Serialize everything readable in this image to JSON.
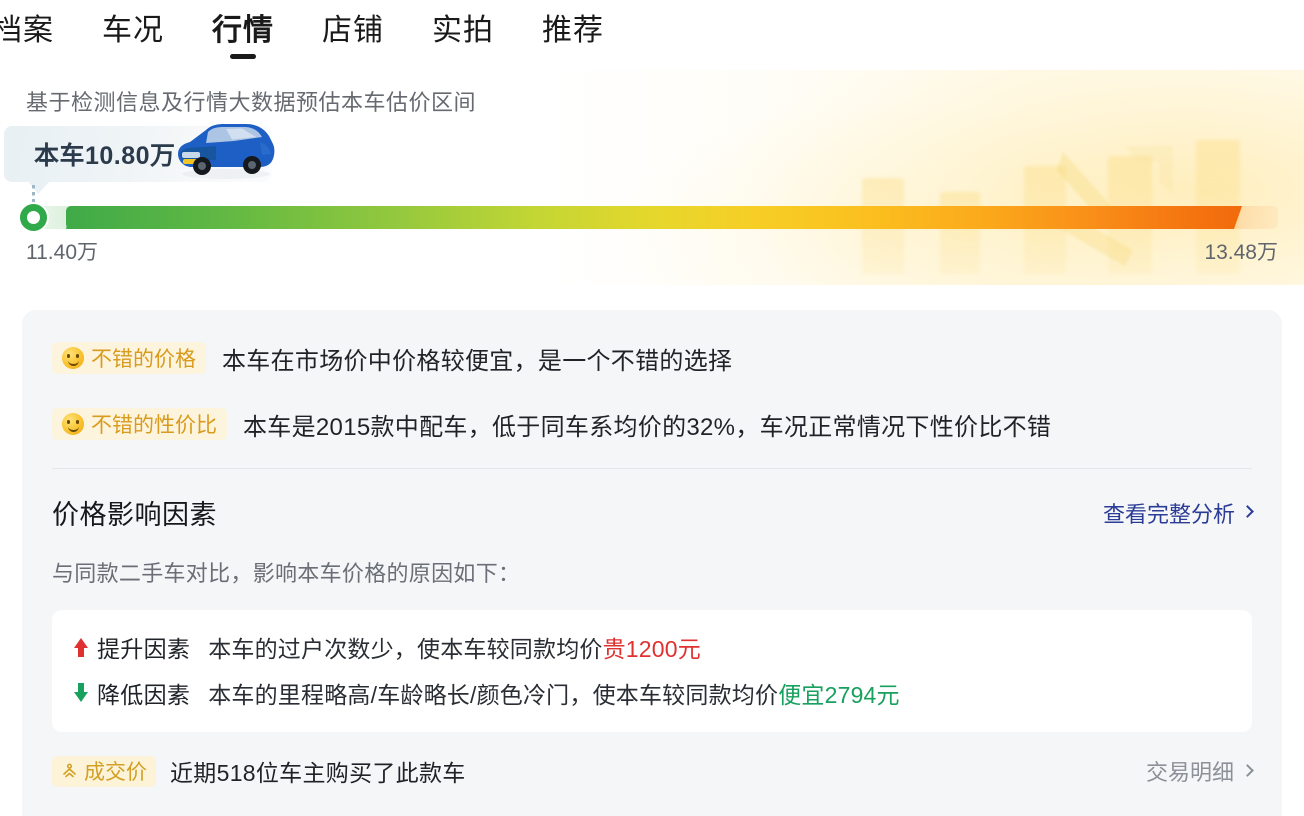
{
  "nav": {
    "items": [
      {
        "label": "档案",
        "active": false
      },
      {
        "label": "车况",
        "active": false
      },
      {
        "label": "行情",
        "active": true
      },
      {
        "label": "店铺",
        "active": false
      },
      {
        "label": "实拍",
        "active": false
      },
      {
        "label": "推荐",
        "active": false
      }
    ]
  },
  "hero": {
    "caption": "基于检测信息及行情大数据预估本车估价区间",
    "bubble_price": "本车10.80万",
    "range_min_label": "11.40万",
    "range_max_label": "13.48万",
    "car_body_color": "#1d5fc4",
    "marker_color": "#2fa94a",
    "gradient_start": "#3faa48",
    "gradient_mid": "#e6d72c",
    "gradient_end": "#f26a0c"
  },
  "assessments": [
    {
      "badge": "不错的价格",
      "icon": "smiley-face-icon",
      "text": "本车在市场价中价格较便宜，是一个不错的选择"
    },
    {
      "badge": "不错的性价比",
      "icon": "smiley-face-icon",
      "text": "本车是2015款中配车，低于同车系均价的32%，车况正常情况下性价比不错"
    }
  ],
  "factors_section": {
    "title": "价格影响因素",
    "link": "查看完整分析",
    "subtitle": "与同款二手车对比，影响本车价格的原因如下：",
    "rows": [
      {
        "direction": "up",
        "label": "提升因素",
        "desc": "本车的过户次数少，使本车较同款均价",
        "highlight": "贵1200元",
        "highlight_color": "#e03131"
      },
      {
        "direction": "down",
        "label": "降低因素",
        "desc": "本车的里程略高/车龄略长/颜色冷门，使本车较同款均价",
        "highlight": "便宜2794元",
        "highlight_color": "#18a05e"
      }
    ]
  },
  "deal": {
    "badge": "成交价",
    "badge_icon": "handshake-icon",
    "text": "近期518位车主购买了此款车",
    "link": "交易明细"
  }
}
